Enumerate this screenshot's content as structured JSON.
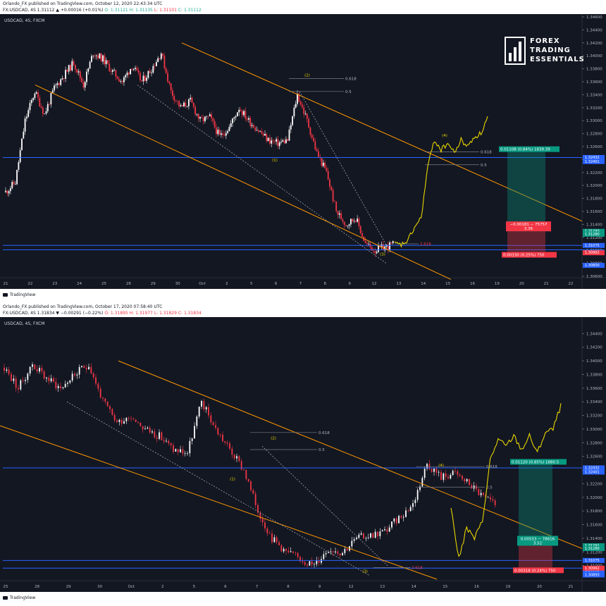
{
  "brand": {
    "line1": "FOREX",
    "line2": "TRADING",
    "line3": "ESSENTIALS"
  },
  "panels": [
    {
      "publisher": "Orlando_FX published on TradingView.com, October 12, 2020 22:43:34 UTC",
      "ohlc_prefix": "FX:USDCAD, 4S  1.31112  ▲  +0.00016 (+0.01%)",
      "o": "O: 1.31121",
      "h": "H: 1.31135",
      "l": "L: 1.31101",
      "c": "C: 1.31112",
      "symbol": "USDCAD, 4S, FXCM",
      "footer_logo": "TradingView",
      "y_ticks": [
        "1.34600",
        "1.34400",
        "1.34200",
        "1.34000",
        "1.33800",
        "1.33600",
        "1.33400",
        "1.33200",
        "1.33000",
        "1.32800",
        "1.32600",
        "1.32400",
        "1.32200",
        "1.32000",
        "1.31800",
        "1.31600",
        "1.31400",
        "1.31200",
        "1.31000",
        "1.30800",
        "1.30600"
      ],
      "x_ticks": [
        "21",
        "22",
        "23",
        "24",
        "25",
        "28",
        "29",
        "30",
        "Oct",
        "2",
        "5",
        "6",
        "7",
        "8",
        "9",
        "12",
        "13",
        "14",
        "15",
        "16",
        "19",
        "20",
        "21",
        "22"
      ],
      "waves": [
        "(2)",
        "(1)",
        "(4)",
        "(3)"
      ],
      "fib_labels": [
        "0.618",
        "0.5",
        "0.618",
        "0.5",
        "2.618"
      ],
      "boxes": {
        "target": "0.01108 (0.84%) 1839.39",
        "entry_line1": "−0.00181 − 75757",
        "entry_line2": "3.36",
        "stop": "0.00330 (0.25%) 750"
      },
      "price_tags": [
        "1.32432",
        "1.32401",
        "1.31293",
        "1.31280",
        "1.31075",
        "1.31007",
        "1.30962",
        "1.30800"
      ]
    },
    {
      "publisher": "Orlando_FX published on TradingView.com, October 17, 2020 07:58:40 UTC",
      "ohlc_prefix": "FX:USDCAD, 4S  1.31834  ▼  −0.00291 (−0.22%)",
      "o": "O: 1.31895",
      "h": "H: 1.31977",
      "l": "L: 1.31829",
      "c": "C: 1.31834",
      "symbol": "USDCAD, 4S, FXCM",
      "footer_logo": "TradingView",
      "y_ticks": [
        "1.34400",
        "1.34200",
        "1.34000",
        "1.33800",
        "1.33600",
        "1.33400",
        "1.33200",
        "1.33000",
        "1.32800",
        "1.32600",
        "1.32400",
        "1.32200",
        "1.32000",
        "1.31800",
        "1.31600",
        "1.31400",
        "1.31200",
        "1.31000"
      ],
      "x_ticks": [
        "25",
        "28",
        "29",
        "30",
        "Oct",
        "2",
        "5",
        "6",
        "7",
        "8",
        "9",
        "12",
        "13",
        "14",
        "15",
        "16",
        "19",
        "20",
        "21"
      ],
      "waves": [
        "(2)",
        "(1)",
        "(4)",
        "(3)"
      ],
      "fib_labels": [
        "0.618",
        "0.5",
        "0.618",
        "0.5",
        "2.618"
      ],
      "boxes": {
        "target": "0.01120 (0.85%) 1880.5",
        "entry_line1": "0.00553 − 78616",
        "entry_line2": "3.52",
        "stop": "0.00318 (0.24%) 750"
      },
      "price_tags": [
        "1.32432",
        "1.32401",
        "1.31291",
        "1.31280",
        "1.31075",
        "1.30963",
        "1.30962",
        "1.30893"
      ]
    }
  ],
  "colors": {
    "bg": "#131722",
    "bull": "#ffffff",
    "bear": "#f23645",
    "channel": "#ff9800",
    "projection": "#e8d500",
    "hline": "#2962ff",
    "target": "#089981",
    "stop": "#f23645",
    "dashed": "#b2b5be"
  },
  "chart_data": [
    {
      "type": "candlestick",
      "title": "USDCAD, 4S, FXCM",
      "ylim": [
        1.306,
        1.346
      ],
      "close_path": [
        1.319,
        1.3205,
        1.33,
        1.3345,
        1.331,
        1.335,
        1.337,
        1.339,
        1.3355,
        1.3405,
        1.3395,
        1.3375,
        1.336,
        1.3385,
        1.336,
        1.338,
        1.3405,
        1.3345,
        1.332,
        1.333,
        1.33,
        1.3305,
        1.3275,
        1.329,
        1.332,
        1.33,
        1.3285,
        1.327,
        1.3265,
        1.327,
        1.334,
        1.33,
        1.325,
        1.322,
        1.316,
        1.314,
        1.315,
        1.311,
        1.31,
        1.3105,
        1.311
      ],
      "projection": [
        1.311,
        1.3108,
        1.3115,
        1.3135,
        1.315,
        1.323,
        1.327,
        1.3255,
        1.3265,
        1.325,
        1.327,
        1.326,
        1.3275,
        1.328,
        1.3305
      ],
      "hlines": [
        1.32432,
        1.31075,
        1.31007
      ],
      "grid": true
    },
    {
      "type": "candlestick",
      "title": "USDCAD, 4S, FXCM",
      "ylim": [
        1.308,
        1.346
      ],
      "close_path": [
        1.339,
        1.336,
        1.3395,
        1.3375,
        1.336,
        1.338,
        1.3395,
        1.334,
        1.331,
        1.332,
        1.33,
        1.329,
        1.327,
        1.3265,
        1.334,
        1.33,
        1.327,
        1.324,
        1.318,
        1.314,
        1.312,
        1.311,
        1.31,
        1.3125,
        1.312,
        1.314,
        1.3145,
        1.315,
        1.317,
        1.319,
        1.325,
        1.323,
        1.3235,
        1.322,
        1.32,
        1.3185
      ],
      "projection": [
        1.3185,
        1.311,
        1.3155,
        1.314,
        1.3165,
        1.3255,
        1.3285,
        1.3275,
        1.329,
        1.327,
        1.329,
        1.3265,
        1.3295,
        1.33,
        1.3335
      ],
      "hlines": [
        1.32432,
        1.31075,
        1.30962
      ],
      "grid": true
    }
  ]
}
